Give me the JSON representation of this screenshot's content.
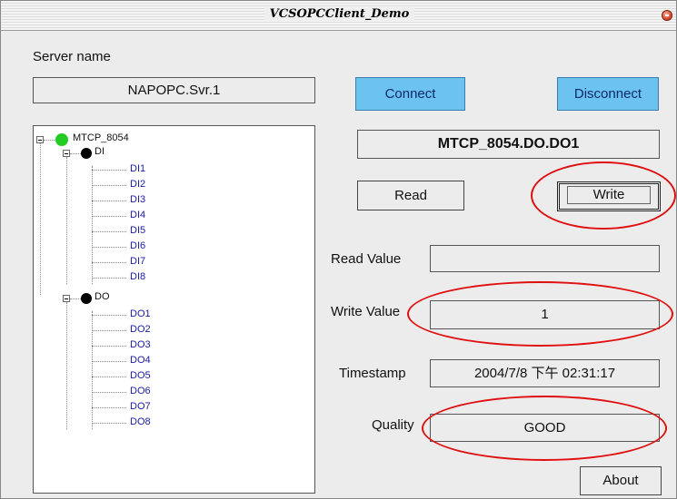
{
  "window": {
    "title": "VCSOPCClient_Demo"
  },
  "server": {
    "label": "Server name",
    "value": "NAPOPC.Svr.1"
  },
  "buttons": {
    "connect": "Connect",
    "disconnect": "Disconnect",
    "read": "Read",
    "write": "Write",
    "about": "About"
  },
  "selected_tag": "MTCP_8054.DO.DO1",
  "fields": {
    "read_value_label": "Read Value",
    "read_value": "",
    "write_value_label": "Write Value",
    "write_value": "1",
    "timestamp_label": "Timestamp",
    "timestamp": "2004/7/8 下午 02:31:17",
    "quality_label": "Quality",
    "quality": "GOOD"
  },
  "tree": {
    "root": "MTCP_8054",
    "groups": [
      {
        "name": "DI",
        "items": [
          "DI1",
          "DI2",
          "DI3",
          "DI4",
          "DI5",
          "DI6",
          "DI7",
          "DI8"
        ]
      },
      {
        "name": "DO",
        "items": [
          "DO1",
          "DO2",
          "DO3",
          "DO4",
          "DO5",
          "DO6",
          "DO7",
          "DO8"
        ]
      }
    ]
  },
  "colors": {
    "connect_button": "#6cc3ef",
    "root_node": "#22cc22",
    "group_node": "#000000",
    "annotation": "#e01010",
    "tree_item_text": "#1a1aa0"
  }
}
